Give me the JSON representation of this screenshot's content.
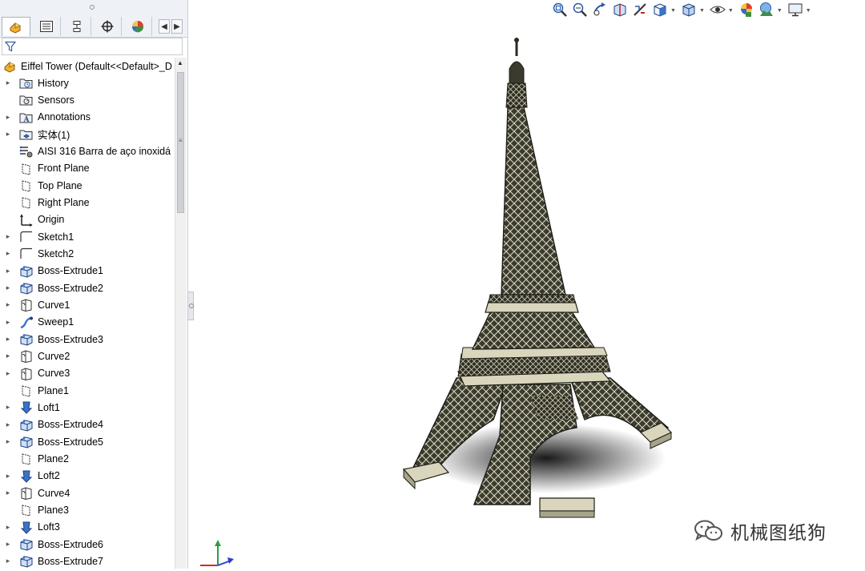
{
  "panel": {
    "tabs": [
      {
        "name": "feature-manager-tab",
        "icon": "feature-tree-icon",
        "active": true
      },
      {
        "name": "property-manager-tab",
        "icon": "property-list-icon",
        "active": false
      },
      {
        "name": "configuration-manager-tab",
        "icon": "configuration-icon",
        "active": false
      },
      {
        "name": "dimxpert-manager-tab",
        "icon": "crosshair-icon",
        "active": false
      },
      {
        "name": "display-manager-tab",
        "icon": "pie-icon",
        "active": false
      }
    ],
    "filter_icon": "funnel-icon",
    "root": {
      "label": "Eiffel Tower  (Default<<Default>_D",
      "icon": "part-icon"
    },
    "items": [
      {
        "label": "History",
        "icon": "history-folder-icon",
        "expandable": true
      },
      {
        "label": "Sensors",
        "icon": "sensors-folder-icon",
        "expandable": false
      },
      {
        "label": "Annotations",
        "icon": "annotations-folder-icon",
        "expandable": true
      },
      {
        "label": "实体(1)",
        "icon": "solid-bodies-folder-icon",
        "expandable": true
      },
      {
        "label": "AISI 316 Barra de aço inoxidá",
        "icon": "material-icon",
        "expandable": false
      },
      {
        "label": "Front Plane",
        "icon": "plane-icon",
        "expandable": false
      },
      {
        "label": "Top Plane",
        "icon": "plane-icon",
        "expandable": false
      },
      {
        "label": "Right Plane",
        "icon": "plane-icon",
        "expandable": false
      },
      {
        "label": "Origin",
        "icon": "origin-icon",
        "expandable": false
      },
      {
        "label": "Sketch1",
        "icon": "sketch-icon",
        "expandable": true
      },
      {
        "label": "Sketch2",
        "icon": "sketch-icon",
        "expandable": true
      },
      {
        "label": "Boss-Extrude1",
        "icon": "extrude-icon",
        "expandable": true
      },
      {
        "label": "Boss-Extrude2",
        "icon": "extrude-icon",
        "expandable": true
      },
      {
        "label": "Curve1",
        "icon": "curve-icon",
        "expandable": true
      },
      {
        "label": "Sweep1",
        "icon": "sweep-icon",
        "expandable": true
      },
      {
        "label": "Boss-Extrude3",
        "icon": "extrude-icon",
        "expandable": true
      },
      {
        "label": "Curve2",
        "icon": "curve-icon",
        "expandable": true
      },
      {
        "label": "Curve3",
        "icon": "curve-icon",
        "expandable": true
      },
      {
        "label": "Plane1",
        "icon": "plane-icon",
        "expandable": false
      },
      {
        "label": "Loft1",
        "icon": "loft-icon",
        "expandable": true
      },
      {
        "label": "Boss-Extrude4",
        "icon": "extrude-icon",
        "expandable": true
      },
      {
        "label": "Boss-Extrude5",
        "icon": "extrude-icon",
        "expandable": true
      },
      {
        "label": "Plane2",
        "icon": "plane-icon",
        "expandable": false
      },
      {
        "label": "Loft2",
        "icon": "loft-icon",
        "expandable": true
      },
      {
        "label": "Curve4",
        "icon": "curve-icon",
        "expandable": true
      },
      {
        "label": "Plane3",
        "icon": "plane-icon",
        "expandable": false
      },
      {
        "label": "Loft3",
        "icon": "loft-icon",
        "expandable": true
      },
      {
        "label": "Boss-Extrude6",
        "icon": "extrude-icon",
        "expandable": true
      },
      {
        "label": "Boss-Extrude7",
        "icon": "extrude-icon",
        "expandable": true
      }
    ]
  },
  "hud_toolbar": [
    {
      "name": "zoom-to-fit-button",
      "icon": "zoom-fit-icon",
      "dropdown": false
    },
    {
      "name": "zoom-to-area-button",
      "icon": "zoom-area-icon",
      "dropdown": false
    },
    {
      "name": "previous-view-button",
      "icon": "previous-view-icon",
      "dropdown": false
    },
    {
      "name": "section-view-button",
      "icon": "section-view-icon",
      "dropdown": false
    },
    {
      "name": "dynamic-annotation-button",
      "icon": "annotation-view-icon",
      "dropdown": false
    },
    {
      "name": "view-orientation-button",
      "icon": "view-orientation-icon",
      "dropdown": true
    },
    {
      "name": "display-style-button",
      "icon": "display-style-icon",
      "dropdown": true
    },
    {
      "name": "hide-show-items-button",
      "icon": "eye-icon",
      "dropdown": true
    },
    {
      "name": "edit-appearance-button",
      "icon": "appearance-icon",
      "dropdown": false
    },
    {
      "name": "apply-scene-button",
      "icon": "scene-icon",
      "dropdown": true
    },
    {
      "name": "view-settings-button",
      "icon": "monitor-icon",
      "dropdown": true
    }
  ],
  "watermark": {
    "text": "机械图纸狗",
    "icon": "wechat-icon"
  },
  "colors": {
    "model_dark": "#2b2b22",
    "model_light": "#d9d6bd",
    "panel_bg": "#ffffff",
    "toolbar_bg": "#eef1f5"
  }
}
